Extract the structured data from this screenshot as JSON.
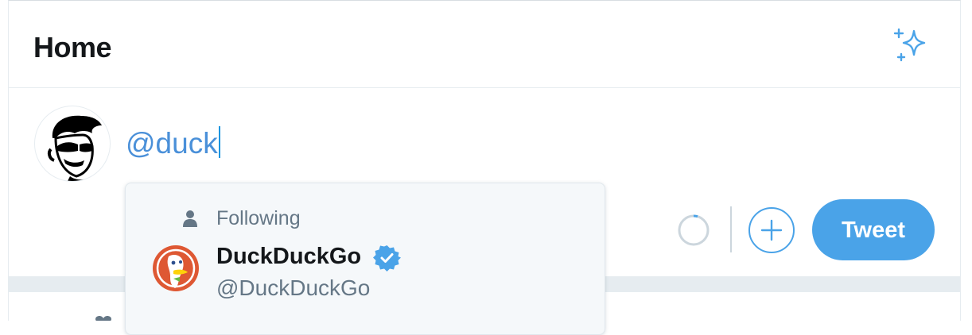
{
  "header": {
    "title": "Home",
    "sparkle_icon": "sparkle-icon"
  },
  "composer": {
    "value": "@duck",
    "send_label": "Tweet",
    "add_icon": "plus-icon",
    "progress_icon": "circle-progress-icon",
    "accent_color": "#4aa3e8"
  },
  "autocomplete": {
    "section_label": "Following",
    "section_icon": "person-icon",
    "items": [
      {
        "name": "DuckDuckGo",
        "handle": "@DuckDuckGo",
        "verified": true,
        "avatar_icon": "duckduckgo-logo"
      }
    ]
  }
}
